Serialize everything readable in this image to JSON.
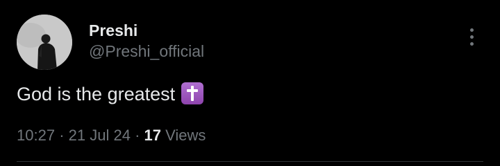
{
  "author": {
    "display_name": "Preshi",
    "handle": "@Preshi_official"
  },
  "post": {
    "text": "God is the greatest",
    "emoji": "latin-cross-emoji"
  },
  "meta": {
    "time": "10:27",
    "separator": "·",
    "date": "21 Jul 24",
    "views_count": "17",
    "views_label": "Views"
  },
  "colors": {
    "background": "#000000",
    "primary_text": "#e7e9ea",
    "secondary_text": "#71767b",
    "emoji_purple": "#9b59b6",
    "divider": "#2f3336"
  },
  "icons": {
    "more": "more-vertical-icon"
  }
}
